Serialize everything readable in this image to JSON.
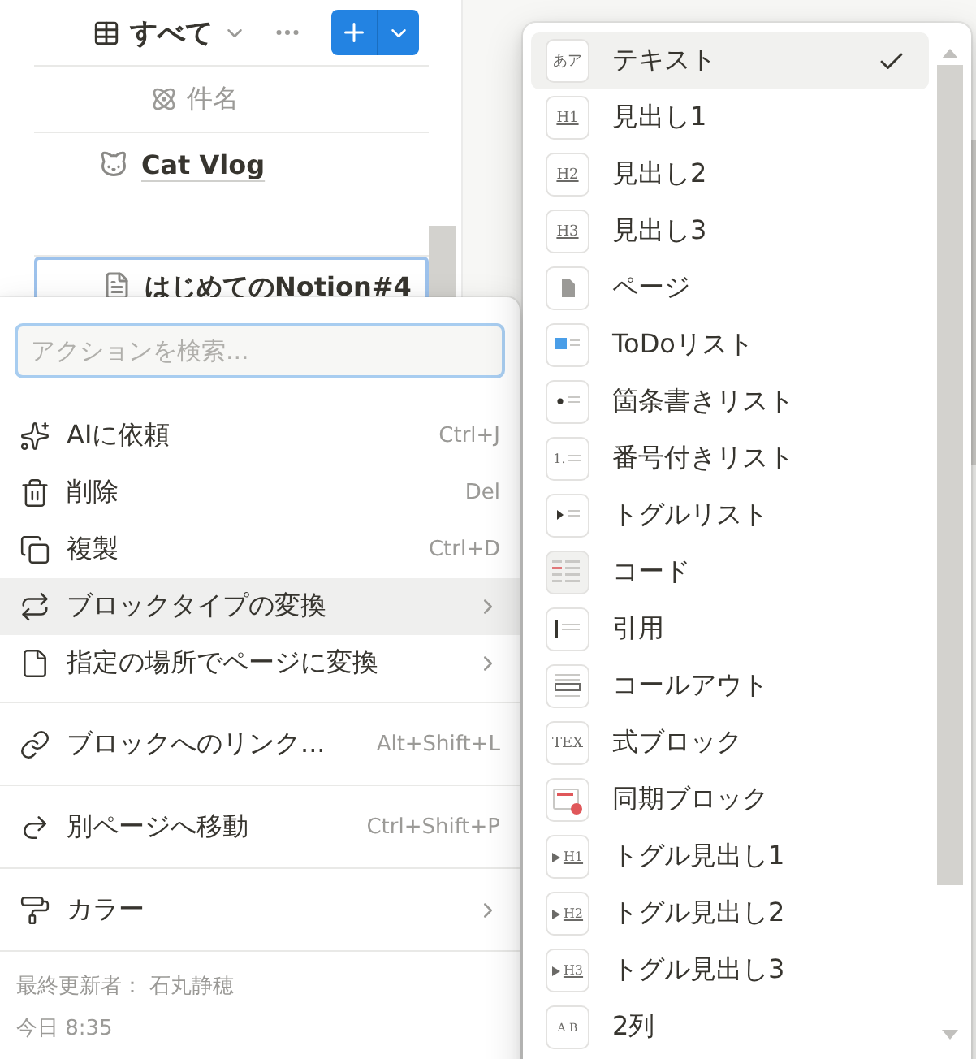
{
  "view": {
    "title": "すべて",
    "column_header": "件名",
    "rows": [
      {
        "title": "Cat Vlog",
        "kind": "cat",
        "selected": false
      },
      {
        "title": "はじめてのNotion#4",
        "kind": "doc",
        "selected": true
      }
    ]
  },
  "action_menu": {
    "search": {
      "placeholder": "アクションを検索..."
    },
    "groups": [
      {
        "items": [
          {
            "label": "AIに依頼",
            "kind": "sparkles",
            "shortcut": "Ctrl+J",
            "submenu": false,
            "selected": false
          },
          {
            "label": "削除",
            "kind": "trash",
            "shortcut": "Del",
            "submenu": false,
            "selected": false
          },
          {
            "label": "複製",
            "kind": "copy",
            "shortcut": "Ctrl+D",
            "submenu": false,
            "selected": false
          },
          {
            "label": "ブロックタイプの変換",
            "kind": "convert",
            "submenu": true,
            "selected": true
          },
          {
            "label": "指定の場所でページに変換",
            "kind": "page",
            "submenu": true,
            "selected": false
          }
        ]
      },
      {
        "items": [
          {
            "label": "ブロックへのリンク...",
            "kind": "link",
            "shortcut": "Alt+Shift+L",
            "submenu": false,
            "selected": false
          }
        ]
      },
      {
        "items": [
          {
            "label": "別ページへ移動",
            "kind": "move",
            "shortcut": "Ctrl+Shift+P",
            "submenu": false,
            "selected": false
          }
        ]
      },
      {
        "items": [
          {
            "label": "カラー",
            "kind": "color",
            "submenu": true,
            "selected": false
          }
        ]
      }
    ],
    "footer": {
      "edited_by": "最終更新者： 石丸静穂",
      "time": "今日 8:35"
    }
  },
  "turn_into_menu": {
    "items": [
      {
        "label": "テキスト",
        "kind": "text",
        "glyph": "あア",
        "selected": true
      },
      {
        "label": "見出し1",
        "kind": "heading",
        "glyph": "H1",
        "selected": false
      },
      {
        "label": "見出し2",
        "kind": "heading",
        "glyph": "H2",
        "selected": false
      },
      {
        "label": "見出し3",
        "kind": "heading",
        "glyph": "H3",
        "selected": false
      },
      {
        "label": "ページ",
        "kind": "page",
        "selected": false
      },
      {
        "label": "ToDoリスト",
        "kind": "todo",
        "selected": false
      },
      {
        "label": "箇条書きリスト",
        "kind": "bullet",
        "selected": false
      },
      {
        "label": "番号付きリスト",
        "kind": "numbered",
        "glyph": "1.",
        "selected": false
      },
      {
        "label": "トグルリスト",
        "kind": "toggle",
        "selected": false
      },
      {
        "label": "コード",
        "kind": "code",
        "selected": false
      },
      {
        "label": "引用",
        "kind": "quote",
        "selected": false
      },
      {
        "label": "コールアウト",
        "kind": "callout",
        "selected": false
      },
      {
        "label": "式ブロック",
        "kind": "equation",
        "glyph": "TEX",
        "selected": false
      },
      {
        "label": "同期ブロック",
        "kind": "synced",
        "selected": false
      },
      {
        "label": "トグル見出し1",
        "kind": "toggle_heading",
        "glyph": "H1",
        "selected": false
      },
      {
        "label": "トグル見出し2",
        "kind": "toggle_heading",
        "glyph": "H2",
        "selected": false
      },
      {
        "label": "トグル見出し3",
        "kind": "toggle_heading",
        "glyph": "H3",
        "selected": false
      },
      {
        "label": "2列",
        "kind": "columns",
        "glyph": "A B",
        "selected": false
      }
    ]
  }
}
